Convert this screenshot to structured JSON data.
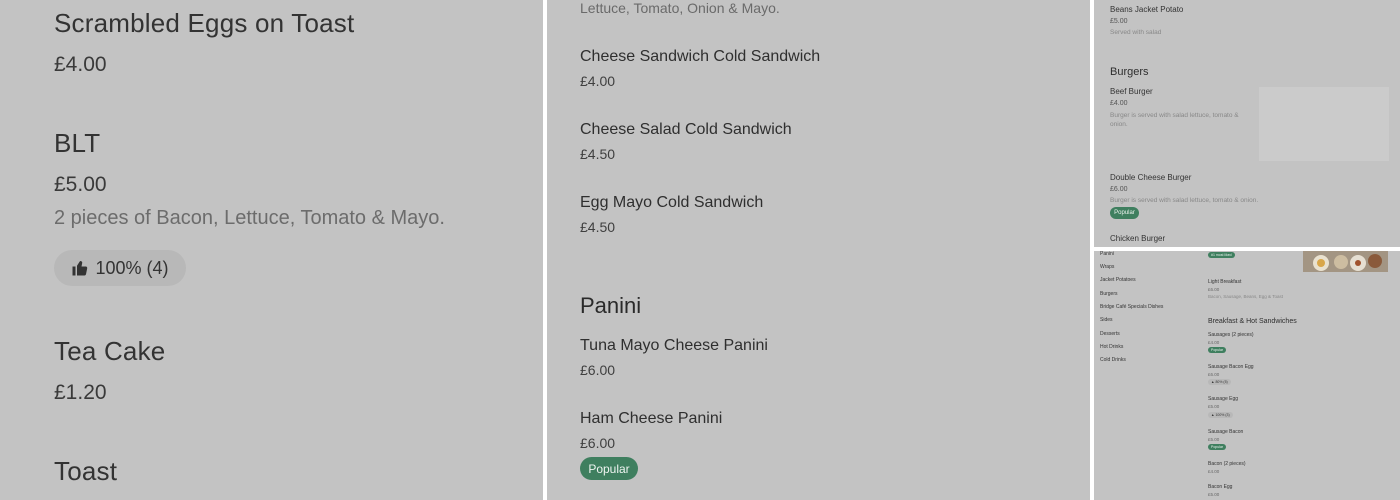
{
  "panel1": {
    "item1": {
      "name": "Scrambled Eggs on Toast",
      "price": "£4.00"
    },
    "item2": {
      "name": "BLT",
      "price": "£5.00",
      "desc": "2 pieces of Bacon, Lettuce, Tomato & Mayo.",
      "rating": "100% (4)"
    },
    "item3": {
      "name": "Tea Cake",
      "price": "£1.20"
    },
    "item4": {
      "name": "Toast"
    }
  },
  "panel2": {
    "top_desc": "Lettuce, Tomato, Onion & Mayo.",
    "item1": {
      "name": "Cheese Sandwich Cold Sandwich",
      "price": "£4.00"
    },
    "item2": {
      "name": "Cheese Salad Cold Sandwich",
      "price": "£4.50"
    },
    "item3": {
      "name": "Egg Mayo Cold Sandwich",
      "price": "£4.50"
    },
    "section": "Panini",
    "item4": {
      "name": "Tuna Mayo Cheese Panini",
      "price": "£6.00"
    },
    "item5": {
      "name": "Ham Cheese Panini",
      "price": "£6.00",
      "badge": "Popular"
    }
  },
  "panel3": {
    "item1": {
      "name": "Beans Jacket Potato",
      "price": "£5.00",
      "desc": "Served with salad"
    },
    "section": "Burgers",
    "item2": {
      "name": "Beef Burger",
      "price": "£4.00",
      "desc": "Burger is served with salad lettuce, tomato & onion."
    },
    "item3": {
      "name": "Double Cheese Burger",
      "price": "£6.00",
      "desc": "Burger is served with salad lettuce, tomato & onion.",
      "badge": "Popular"
    },
    "item4": {
      "name": "Chicken Burger"
    }
  },
  "panel4": {
    "nav": [
      "Panini",
      "Wraps",
      "Jacket Potatoes",
      "Burgers",
      "Bridge Café Specials Dishes",
      "Sides",
      "Desserts",
      "Hot Drinks",
      "Cold Drinks"
    ],
    "top_badge": "#1 most liked",
    "item0": {
      "name": "Light Breakfast",
      "price": "£6.00",
      "desc": "Bacon, Sausage, Beans, Egg & Toast"
    },
    "section": "Breakfast & Hot Sandwiches",
    "item1": {
      "name": "Sausages (2 pieces)",
      "price": "£4.00",
      "badge": "Popular"
    },
    "item2": {
      "name": "Sausage Bacon Egg",
      "price": "£6.00",
      "rating": "80% (5)"
    },
    "item3": {
      "name": "Sausage Egg",
      "price": "£5.00",
      "rating": "100% (3)"
    },
    "item4": {
      "name": "Sausage Bacon",
      "price": "£5.00",
      "badge": "Popular"
    },
    "item5": {
      "name": "Bacon (2 pieces)",
      "price": "£4.00"
    },
    "item6": {
      "name": "Bacon Egg",
      "price": "£5.00"
    }
  }
}
